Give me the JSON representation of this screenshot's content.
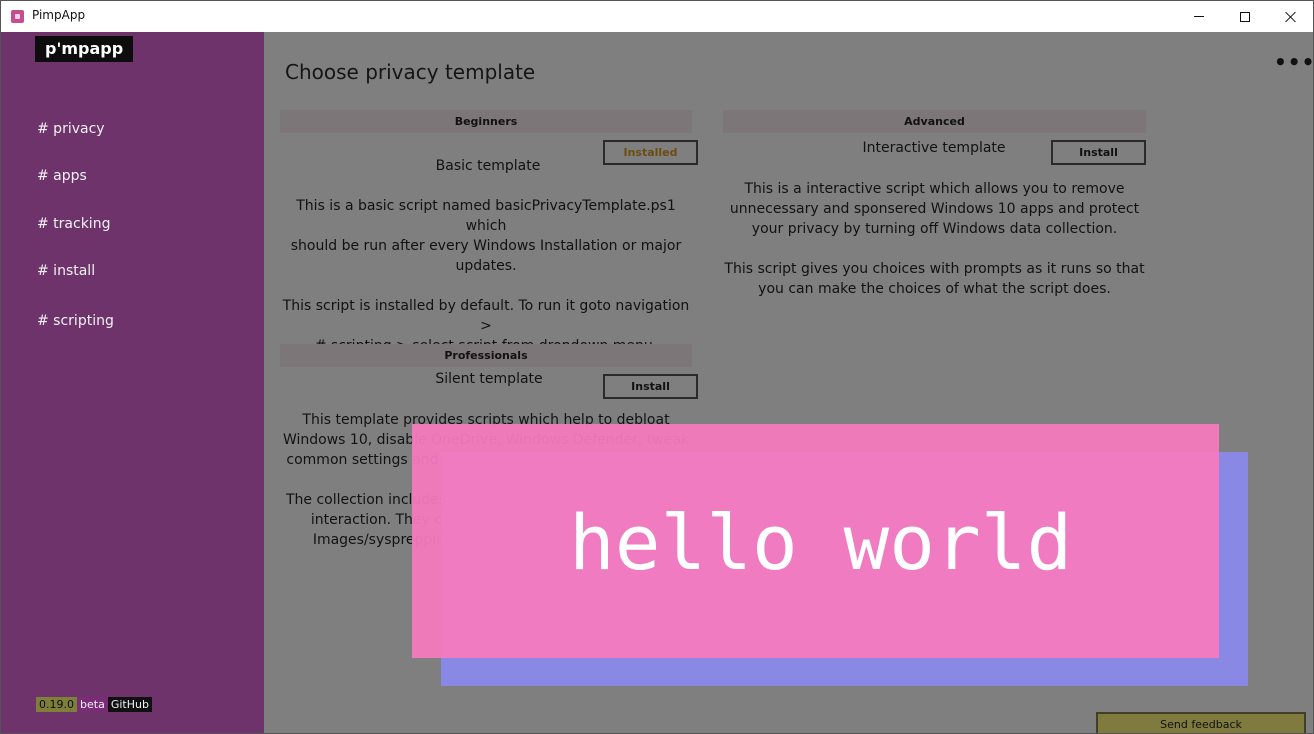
{
  "window": {
    "title": "PimpApp"
  },
  "sidebar": {
    "brand": "p'mpapp",
    "items": [
      {
        "label": "# privacy"
      },
      {
        "label": "# apps"
      },
      {
        "label": "# tracking"
      },
      {
        "label": "# install"
      },
      {
        "label": "# scripting"
      }
    ],
    "version": "0.19.0",
    "beta": "beta",
    "github": "GitHub"
  },
  "main": {
    "title": "Choose privacy template",
    "more_label": "•••",
    "sections": {
      "beginners": {
        "header": "Beginners",
        "template_name": "Basic template",
        "button": "Installed",
        "description": [
          "This is a basic script named basicPrivacyTemplate.ps1 which",
          "should be run after every Windows Installation or major",
          "updates.",
          "",
          "This script is installed by default. To run it goto navigation >",
          "# scripting > select script from dropdown menu."
        ]
      },
      "advanced": {
        "header": "Advanced",
        "template_name": "Interactive template",
        "button": "Install",
        "description": [
          "This is a interactive script which allows you to remove",
          "unnecessary and sponsered Windows 10 apps and protect",
          "your privacy by turning off Windows data collection.",
          "",
          "This script gives you choices with prompts as it runs so that",
          "you can make the choices of what the script does."
        ]
      },
      "professionals": {
        "header": "Professionals",
        "template_name": "Silent template",
        "button": "Install",
        "description": [
          "This template provides scripts which help to debloat",
          "Windows 10, disable OneDrive, Windows Defender, tweak",
          "common settings and install basic software components.",
          "",
          "The collection includes six scripts which run without user",
          "interaction. They can be useful for deploying MDT",
          "Images/sysprepping or any other way you deploy Windows"
        ]
      }
    },
    "feedback_label": "Send feedback"
  },
  "overlay": {
    "text": "hello world",
    "colors": {
      "front": "#f67abe",
      "back": "#8a88e8"
    }
  },
  "colors": {
    "sidebar": "#6f336c",
    "content": "#7f7f7f",
    "brand_bg": "#0d0d0d"
  }
}
